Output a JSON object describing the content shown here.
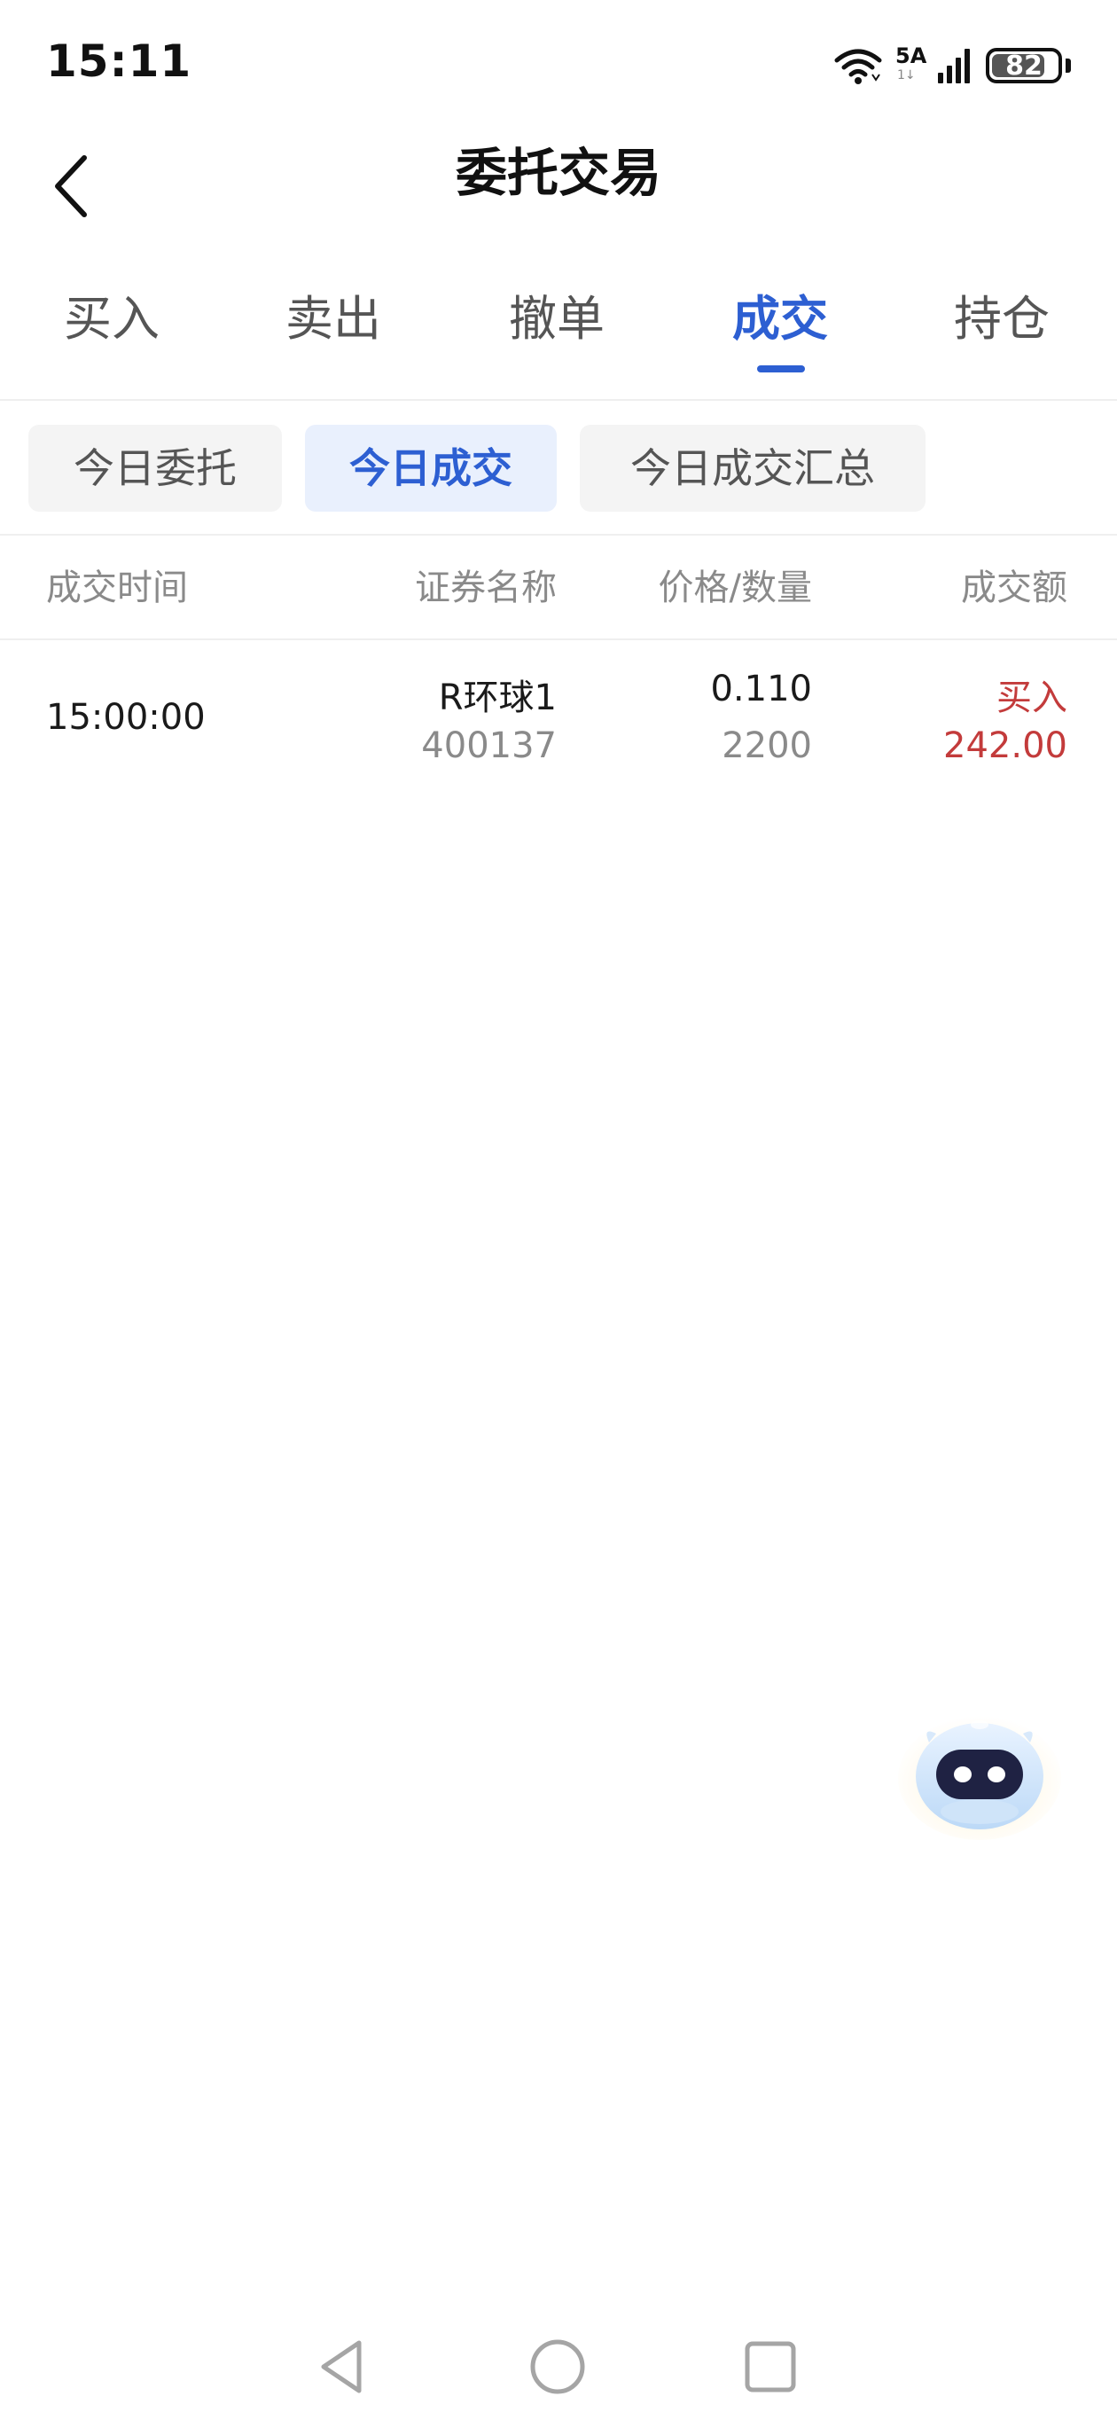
{
  "status_bar": {
    "time": "15:11",
    "network": "5A",
    "network_sub": "1↓",
    "battery": "82"
  },
  "header": {
    "title": "委托交易",
    "back_icon": "chevron-left-icon"
  },
  "main_tabs": [
    {
      "label": "买入"
    },
    {
      "label": "卖出"
    },
    {
      "label": "撤单"
    },
    {
      "label": "成交",
      "active": true
    },
    {
      "label": "持仓"
    }
  ],
  "sub_tabs": [
    {
      "label": "今日委托"
    },
    {
      "label": "今日成交",
      "active": true
    },
    {
      "label": "今日成交汇总"
    }
  ],
  "table": {
    "columns": [
      "成交时间",
      "证券名称",
      "价格/数量",
      "成交额"
    ],
    "rows": [
      {
        "time": "15:00:00",
        "name": "R环球1",
        "code": "400137",
        "price": "0.110",
        "quantity": "2200",
        "direction": "买入",
        "amount": "242.00"
      }
    ]
  },
  "colors": {
    "accent": "#2d5fd2",
    "buy_red": "#c33b3b",
    "muted": "#8a8a8a"
  },
  "assistant": {
    "icon": "robot-assistant-icon"
  },
  "nav_bar": {
    "back": "nav-back-icon",
    "home": "nav-home-icon",
    "recents": "nav-recents-icon"
  }
}
